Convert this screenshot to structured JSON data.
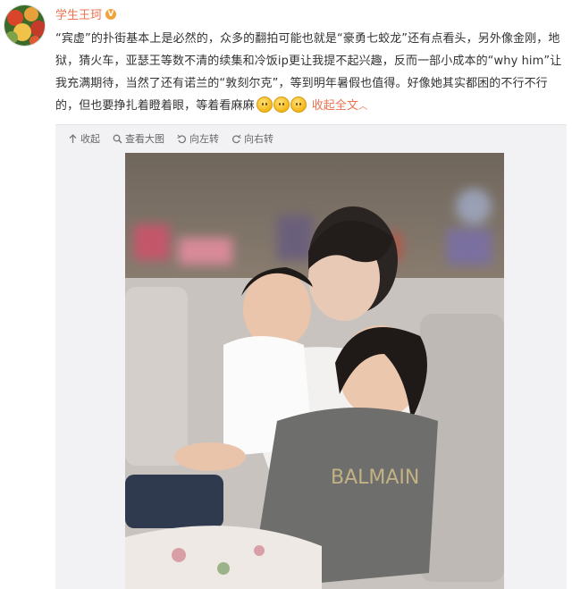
{
  "author": {
    "name": "学生王珂",
    "badge_icon": "vip-badge-icon"
  },
  "post": {
    "text_part1": "“宾虚”的扑街基本上是必然的，众多的翻拍可能也就是“豪勇七蛟龙”还有点看头，另外像金刚，地狱，猜火车，亚瑟王等数不清的续集和冷饭ip更让我提不起兴趣，反而一部小成本的“why him”让我充满期待，当然了还有诺兰的“敦刻尔克”，等到明年暑假也值得。好像她其实都困的不行不行的，但也要挣扎着瞪着眼，等着看麻麻",
    "emoji_icons": [
      "sleepy-face-icon",
      "sleepy-face-icon",
      "sleepy-face-icon"
    ],
    "collapse_label": "收起全文",
    "collapse_icon": "chevron-up-icon"
  },
  "media_toolbar": {
    "collapse": "收起",
    "view_large": "查看大图",
    "rotate_left": "向左转",
    "rotate_right": "向右转"
  },
  "colors": {
    "link": "#eb7350",
    "text": "#333333",
    "toolbar_bg": "#f2f2f5"
  }
}
